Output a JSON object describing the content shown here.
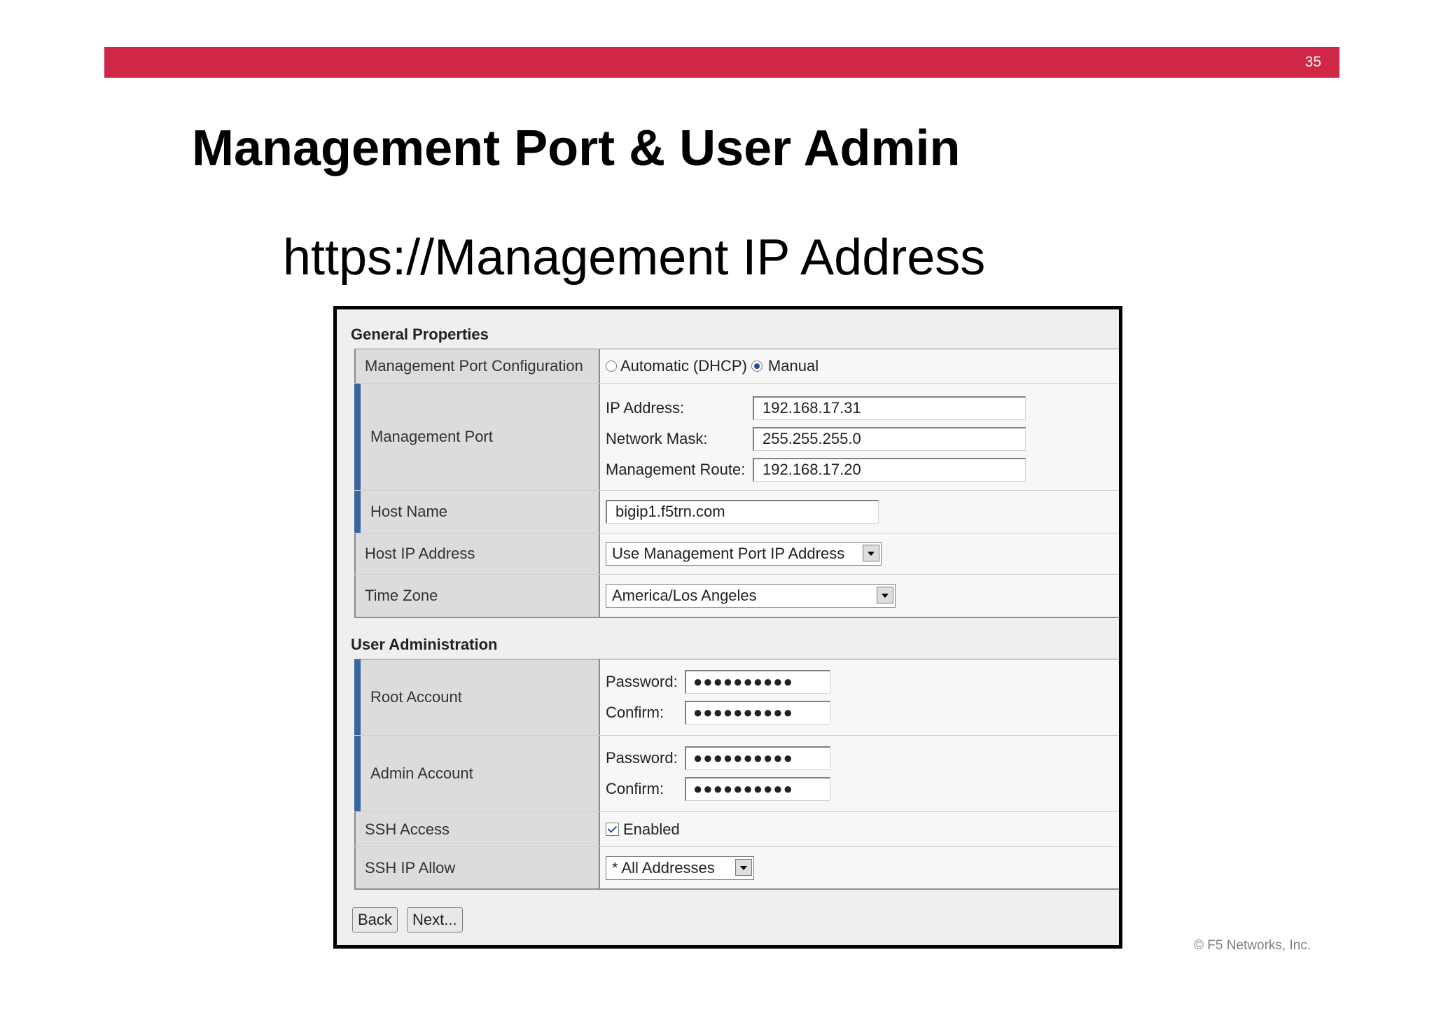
{
  "slide": {
    "page_number": "35",
    "title": "Management Port & User Admin",
    "subtitle": "https://Management IP Address",
    "copyright": "© F5 Networks, Inc."
  },
  "general": {
    "heading": "General Properties",
    "port_config": {
      "label": "Management Port Configuration",
      "option_auto": "Automatic (DHCP)",
      "option_manual": "Manual",
      "selected": "Manual"
    },
    "management_port": {
      "label": "Management Port",
      "ip_label": "IP Address:",
      "ip_value": "192.168.17.31",
      "mask_label": "Network Mask:",
      "mask_value": "255.255.255.0",
      "route_label": "Management Route:",
      "route_value": "192.168.17.20"
    },
    "host_name": {
      "label": "Host Name",
      "value": "bigip1.f5trn.com"
    },
    "host_ip": {
      "label": "Host IP Address",
      "value": "Use Management Port IP Address"
    },
    "time_zone": {
      "label": "Time Zone",
      "value": "America/Los Angeles"
    }
  },
  "user_admin": {
    "heading": "User Administration",
    "root": {
      "label": "Root Account",
      "password_label": "Password:",
      "password_value": "●●●●●●●●●●",
      "confirm_label": "Confirm:",
      "confirm_value": "●●●●●●●●●●"
    },
    "admin": {
      "label": "Admin Account",
      "password_label": "Password:",
      "password_value": "●●●●●●●●●●",
      "confirm_label": "Confirm:",
      "confirm_value": "●●●●●●●●●●"
    },
    "ssh_access": {
      "label": "SSH Access",
      "checkbox_label": "Enabled",
      "checked": true
    },
    "ssh_ip_allow": {
      "label": "SSH IP Allow",
      "value": "* All Addresses"
    }
  },
  "buttons": {
    "back": "Back",
    "next": "Next..."
  },
  "colors": {
    "accent_bar": "#cf2745",
    "required_marker": "#3a64a0"
  }
}
